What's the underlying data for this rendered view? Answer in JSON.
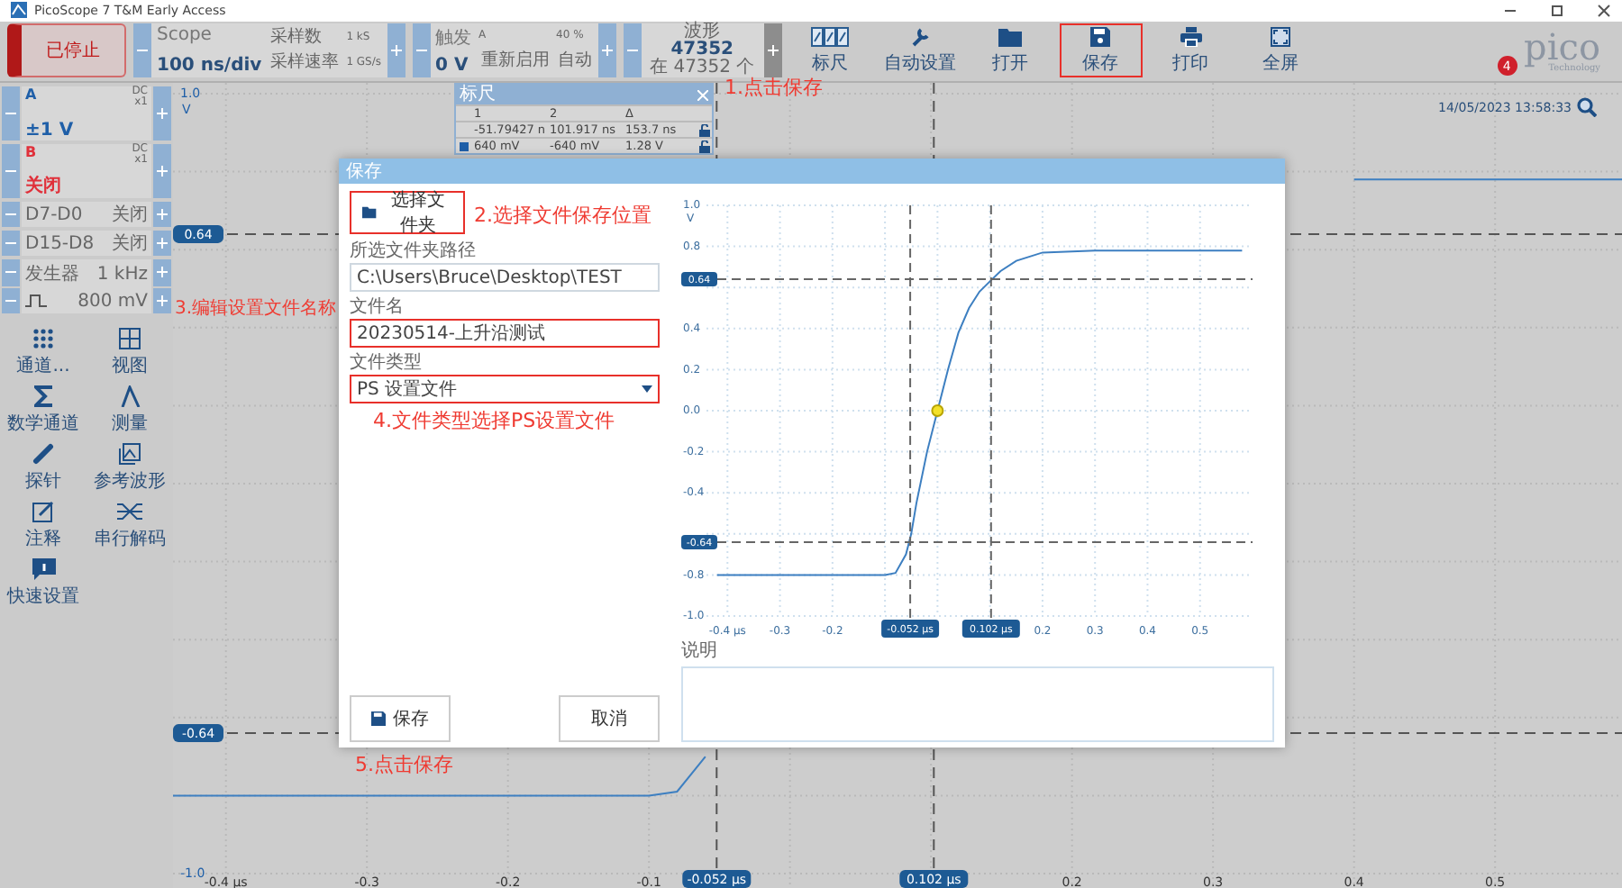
{
  "window": {
    "title": "PicoScope 7 T&M Early Access"
  },
  "toolbar": {
    "run_status": "已停止",
    "timebase": {
      "label": "Scope",
      "value": "100 ns/div",
      "samples_label": "采样数",
      "samples": "1 kS",
      "rate_label": "采样速率",
      "rate": "1 GS/s"
    },
    "trigger": {
      "label": "触发",
      "value": "0 V",
      "channel": "A",
      "pretrigger": "40 %",
      "mode_label": "重新启用",
      "mode": "自动"
    },
    "waveform": {
      "label": "波形",
      "value": "47352",
      "total": "在 47352 个"
    },
    "buttons": [
      {
        "label": "标尺",
        "kind": "rulers",
        "highlighted": false
      },
      {
        "label": "自动设置",
        "kind": "auto",
        "highlighted": false
      },
      {
        "label": "打开",
        "kind": "open",
        "highlighted": false
      },
      {
        "label": "保存",
        "kind": "save",
        "highlighted": true
      },
      {
        "label": "打印",
        "kind": "print",
        "highlighted": false
      },
      {
        "label": "全屏",
        "kind": "fullscreen",
        "highlighted": false
      }
    ],
    "notification_count": "4",
    "logo": "pico",
    "logo_subtitle": "Technology"
  },
  "sidebar": {
    "channels": [
      {
        "name": "A",
        "coupling": "DC",
        "probe": "x1",
        "range": "±1 V",
        "color": "#1f5fa8"
      },
      {
        "name": "B",
        "coupling": "DC",
        "probe": "x1",
        "range": "关闭",
        "color": "#e0303a"
      }
    ],
    "digital": [
      {
        "name": "D7-D0",
        "state": "关闭"
      },
      {
        "name": "D15-D8",
        "state": "关闭"
      }
    ],
    "generator": {
      "label": "发生器",
      "frequency": "1 kHz",
      "amplitude": "800 mV"
    },
    "tools": [
      {
        "label": "通道...",
        "kind": "dots"
      },
      {
        "label": "视图",
        "kind": "view"
      },
      {
        "label": "数学通道",
        "kind": "sigma"
      },
      {
        "label": "测量",
        "kind": "measure"
      },
      {
        "label": "探针",
        "kind": "probe"
      },
      {
        "label": "参考波形",
        "kind": "reference"
      },
      {
        "label": "注释",
        "kind": "note"
      },
      {
        "label": "串行解码",
        "kind": "decode"
      },
      {
        "label": "快速设置",
        "kind": "info"
      }
    ]
  },
  "scope": {
    "timestamp": "14/05/2023 13:58:33",
    "chart_data": {
      "type": "line",
      "ylabel": "V",
      "grid": true,
      "x": [
        -0.4375,
        -0.3,
        -0.2,
        -0.1,
        -0.08,
        -0.06,
        -0.05,
        -0.04,
        -0.02,
        0,
        0.02,
        0.04,
        0.06,
        0.08,
        0.1,
        0.12,
        0.15,
        0.2,
        0.3,
        0.4,
        0.5,
        0.59
      ],
      "series": [
        {
          "color": "#3d7fc1",
          "values": [
            -0.8,
            -0.8,
            -0.8,
            -0.8,
            -0.79,
            -0.7,
            null,
            null,
            null,
            null,
            null,
            null,
            null,
            null,
            null,
            null,
            null,
            null,
            null,
            0.78,
            0.78,
            0.78
          ]
        }
      ],
      "xlim": [
        -0.4375,
        0.59
      ],
      "ylim": [
        -1,
        1
      ],
      "xticks": [
        {
          "value": -0.4,
          "label": "-0.4 µs"
        },
        -0.3,
        -0.2,
        -0.1,
        0.2,
        0.3,
        0.4,
        0.5
      ],
      "yticks": [
        {
          "value": 1,
          "label": "1.0"
        },
        {
          "value": -1,
          "label": "-1.0"
        }
      ],
      "ref_lines": [
        {
          "axis": "y",
          "value": 0.64,
          "label": "0.64"
        },
        {
          "axis": "y",
          "value": -0.64,
          "label": "-0.64"
        },
        {
          "axis": "x",
          "value": -0.052,
          "label": "-0.052 µs"
        },
        {
          "axis": "x",
          "value": 0.102,
          "label": "0.102 µs"
        }
      ]
    },
    "cursor_table": {
      "title": "标尺",
      "columns": [
        "1",
        "2",
        "Δ"
      ],
      "rows": [
        {
          "values": [
            "-51.79427 n",
            "101.917 ns",
            "153.7 ns"
          ]
        },
        {
          "color": "#1f5fa8",
          "values": [
            "640 mV",
            "-640 mV",
            "1.28 V"
          ]
        }
      ]
    }
  },
  "dialog": {
    "title": "保存",
    "folder_button": {
      "label": "选择文件夹",
      "highlighted": true
    },
    "path_label": "所选文件夹路径",
    "path": {
      "value": "C:\\Users\\Bruce\\Desktop\\TEST",
      "highlighted": false
    },
    "name_label": "文件名",
    "name": {
      "value": "20230514-上升沿测试",
      "highlighted": true
    },
    "type_label": "文件类型",
    "type": {
      "value": "PS 设置文件",
      "highlighted": true
    },
    "preview": {
      "chart_data": {
        "type": "line",
        "ylabel": "V",
        "grid": true,
        "x": [
          -0.42,
          -0.3,
          -0.2,
          -0.1,
          -0.08,
          -0.06,
          -0.05,
          -0.04,
          -0.02,
          0,
          0.02,
          0.04,
          0.06,
          0.08,
          0.1,
          0.12,
          0.15,
          0.2,
          0.3,
          0.4,
          0.5,
          0.58
        ],
        "series": [
          {
            "color": "#3d7fc1",
            "values": [
              -0.8,
              -0.8,
              -0.8,
              -0.8,
              -0.79,
              -0.7,
              -0.6,
              -0.45,
              -0.2,
              0,
              0.2,
              0.38,
              0.5,
              0.58,
              0.63,
              0.68,
              0.73,
              0.77,
              0.78,
              0.78,
              0.78,
              0.78
            ]
          }
        ],
        "xlim": [
          -0.44,
          0.6
        ],
        "ylim": [
          -1,
          1
        ],
        "xticks": [
          {
            "value": -0.4,
            "label": "-0.4 µs"
          },
          -0.3,
          -0.2,
          0.2,
          0.3,
          0.4,
          0.5
        ],
        "yticks": [
          {
            "value": 1,
            "label": "1.0"
          },
          0.8,
          0.4,
          0.2,
          {
            "value": 0,
            "label": "0.0"
          },
          -0.2,
          -0.4,
          -0.8,
          {
            "value": -1,
            "label": "-1.0"
          }
        ],
        "ref_lines": [
          {
            "axis": "y",
            "value": 0.64,
            "label": "0.64"
          },
          {
            "axis": "y",
            "value": -0.64,
            "label": "-0.64"
          },
          {
            "axis": "x",
            "value": -0.052,
            "label": "-0.052 µs"
          },
          {
            "axis": "x",
            "value": 0.102,
            "label": "0.102 µs"
          }
        ]
      }
    },
    "notes_label": "说明",
    "save_button": "保存",
    "cancel_button": "取消"
  },
  "annotations": [
    {
      "text": "1.点击保存"
    },
    {
      "text": "2.选择文件保存位置"
    },
    {
      "text": "3.编辑设置文件名称"
    },
    {
      "text": "4.文件类型选择PS设置文件"
    },
    {
      "text": "5.点击保存"
    }
  ]
}
